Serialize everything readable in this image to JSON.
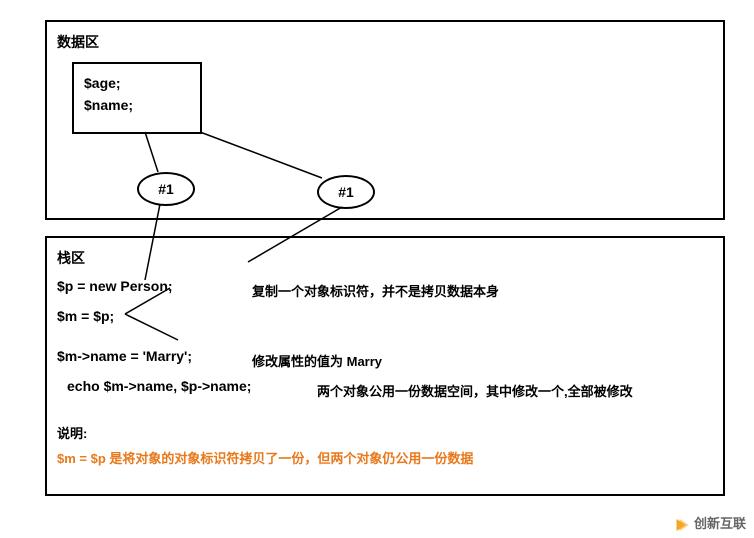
{
  "dataArea": {
    "title": "数据区",
    "vars": {
      "line1": "$age;",
      "line2": "$name;"
    },
    "bubble1": "#1",
    "bubble2": "#1"
  },
  "stackArea": {
    "title": "栈区",
    "code": {
      "l1": "$p = new Person;",
      "l2": "$m = $p;",
      "l3": "$m->name = 'Marry';",
      "l4": "echo $m->name, $p->name;"
    },
    "anno": {
      "a1": "复制一个对象标识符，并不是拷贝数据本身",
      "a3": "修改属性的值为 Marry",
      "a4": "两个对象公用一份数据空间，其中修改一个,全部被修改"
    },
    "explain": {
      "label": "说明:",
      "content": "$m = $p 是将对象的对象标识符拷贝了一份，但两个对象仍公用一份数据"
    }
  },
  "watermark": "创新互联"
}
